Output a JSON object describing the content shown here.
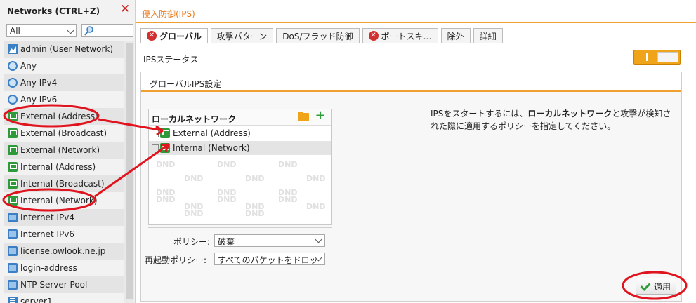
{
  "left_panel": {
    "title": "Networks (CTRL+Z)",
    "filter": {
      "value": "All"
    },
    "search": {
      "value": ""
    },
    "items": [
      {
        "label": "admin (User Network)",
        "icon": "admin-network-icon"
      },
      {
        "label": "Any",
        "icon": "globe-icon"
      },
      {
        "label": "Any IPv4",
        "icon": "globe-icon"
      },
      {
        "label": "Any IPv6",
        "icon": "globe-icon"
      },
      {
        "label": "External (Address)",
        "icon": "green-flag-icon"
      },
      {
        "label": "External (Broadcast)",
        "icon": "green-flag-icon"
      },
      {
        "label": "External (Network)",
        "icon": "green-flag-icon"
      },
      {
        "label": "Internal (Address)",
        "icon": "green-flag-icon"
      },
      {
        "label": "Internal (Broadcast)",
        "icon": "green-flag-icon"
      },
      {
        "label": "Internal (Network)",
        "icon": "green-flag-icon"
      },
      {
        "label": "Internet IPv4",
        "icon": "network-icon"
      },
      {
        "label": "Internet IPv6",
        "icon": "network-icon"
      },
      {
        "label": "license.owlook.ne.jp",
        "icon": "network-icon"
      },
      {
        "label": "login-address",
        "icon": "network-icon"
      },
      {
        "label": "NTP Server Pool",
        "icon": "network-icon"
      },
      {
        "label": "server1",
        "icon": "document-icon"
      }
    ]
  },
  "page": {
    "title": "侵入防御(IPS)",
    "tabs": [
      {
        "label": "グローバル",
        "error": true,
        "active": true
      },
      {
        "label": "攻撃パターン",
        "error": false,
        "active": false
      },
      {
        "label": "DoS/フラッド防御",
        "error": false,
        "active": false
      },
      {
        "label": "ポートスキ…",
        "error": true,
        "active": false
      },
      {
        "label": "除外",
        "error": false,
        "active": false
      },
      {
        "label": "詳細",
        "error": false,
        "active": false
      }
    ],
    "ips_status_label": "IPSステータス",
    "ips_status_on": true
  },
  "global_box": {
    "title": "グローバルIPS設定",
    "local_network": {
      "title": "ローカルネットワーク",
      "rows": [
        "External (Address)",
        "Internal (Network)"
      ],
      "dnd": [
        "DND",
        "DND",
        "DND",
        "DND",
        "DND",
        "DND",
        "DND",
        "DND",
        "DND",
        "DND",
        "DND",
        "DND",
        "DND",
        "DND",
        "DND",
        "DND",
        "DND"
      ]
    },
    "hint_pre": "IPSをスタートするには、",
    "hint_bold": "ローカルネットワーク",
    "hint_post": "と攻撃が検知された際に適用するポリシーを指定してください。",
    "policy_label": "ポリシー:",
    "policy_value": "破棄",
    "restart_policy_label": "再起動ポリシー:",
    "restart_policy_value": "すべてのパケットをドロッ",
    "apply_label": "適用"
  },
  "colors": {
    "accent": "#f0a030",
    "error": "#d23030",
    "annotation": "#e0141e",
    "flag": "#2e9a3a"
  }
}
